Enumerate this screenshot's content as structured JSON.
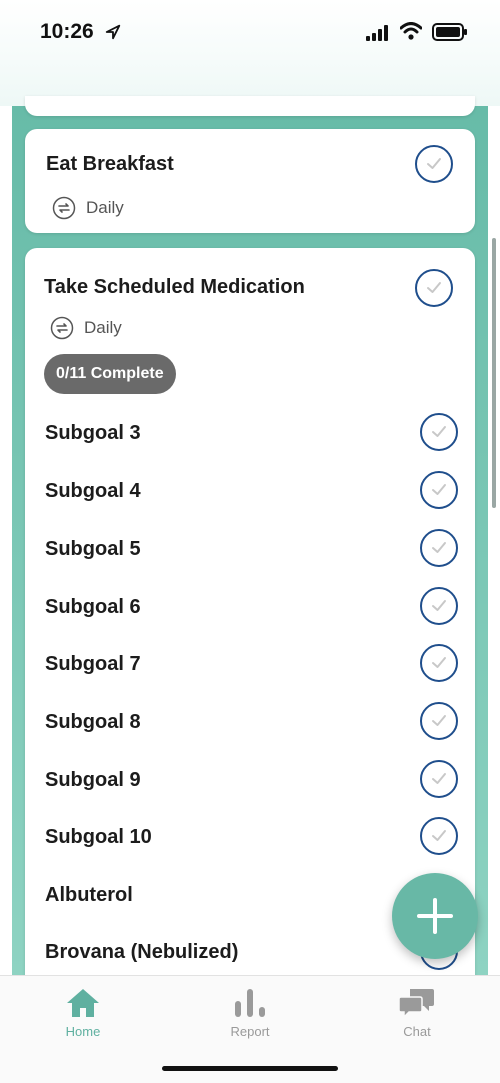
{
  "status": {
    "time": "10:26"
  },
  "cards": {
    "breakfast": {
      "title": "Eat Breakfast",
      "frequency": "Daily"
    },
    "medication": {
      "title": "Take Scheduled Medication",
      "frequency": "Daily",
      "progress_badge": "0/11 Complete",
      "subgoals": [
        "Subgoal 3",
        "Subgoal 4",
        "Subgoal 5",
        "Subgoal 6",
        "Subgoal 7",
        "Subgoal 8",
        "Subgoal 9",
        "Subgoal 10",
        "Albuterol",
        "Brovana (Nebulized)"
      ]
    }
  },
  "tabs": {
    "home": "Home",
    "report": "Report",
    "chat": "Chat"
  },
  "colors": {
    "accent": "#5fb0a0",
    "check_border": "#1f4e8c",
    "badge_bg": "#6a6a6a"
  }
}
